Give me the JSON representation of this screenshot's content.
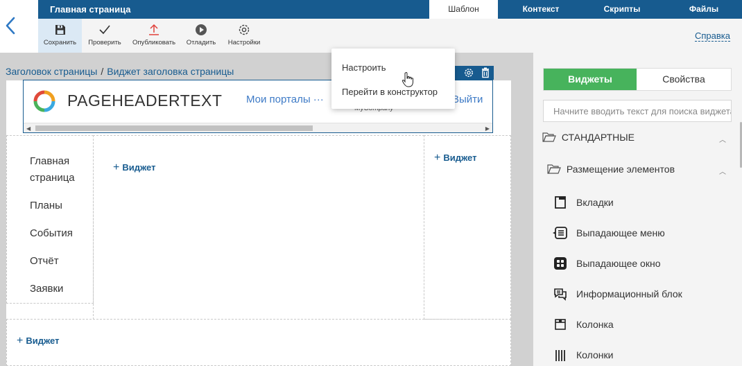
{
  "header": {
    "page_title": "Главная страница",
    "tabs": [
      {
        "label": "Шаблон",
        "active": true
      },
      {
        "label": "Контекст",
        "active": false
      },
      {
        "label": "Скрипты",
        "active": false
      },
      {
        "label": "Файлы",
        "active": false
      }
    ]
  },
  "toolbar": {
    "save_label": "Сохранить",
    "check_label": "Проверить",
    "publish_label": "Опубликовать",
    "debug_label": "Отладить",
    "settings_label": "Настройки",
    "help_label": "Справка"
  },
  "breadcrumb": {
    "root": "Заголовок страницы",
    "separator": "/",
    "current": "Виджет заголовка страницы"
  },
  "page_header_widget": {
    "title": "PAGEHEADERTEXT",
    "portals_link": "Мои порталы",
    "portals_more": "···",
    "logout_link": "Выйти",
    "company": "MyCompany"
  },
  "context_menu": {
    "items": [
      "Настроить",
      "Перейти в конструктор"
    ]
  },
  "sidebar_nav": {
    "items": [
      "Главная страница",
      "Планы",
      "События",
      "Отчёт",
      "Заявки"
    ]
  },
  "add_widget_label": "Виджет",
  "panel": {
    "tabs": [
      {
        "label": "Виджеты",
        "active": true
      },
      {
        "label": "Свойства",
        "active": false
      }
    ],
    "search_placeholder": "Начните вводить текст для поиска виджета",
    "groups": {
      "standard": "СТАНДАРТНЫЕ",
      "layout": "Размещение элементов"
    },
    "widgets": [
      "Вкладки",
      "Выпадающее меню",
      "Выпадающее окно",
      "Информационный блок",
      "Колонка",
      "Колонки"
    ]
  },
  "colors": {
    "primary": "#175b8f",
    "accent_green": "#47b35c",
    "link_blue": "#3d7ac6",
    "publish_red": "#e0403a"
  }
}
